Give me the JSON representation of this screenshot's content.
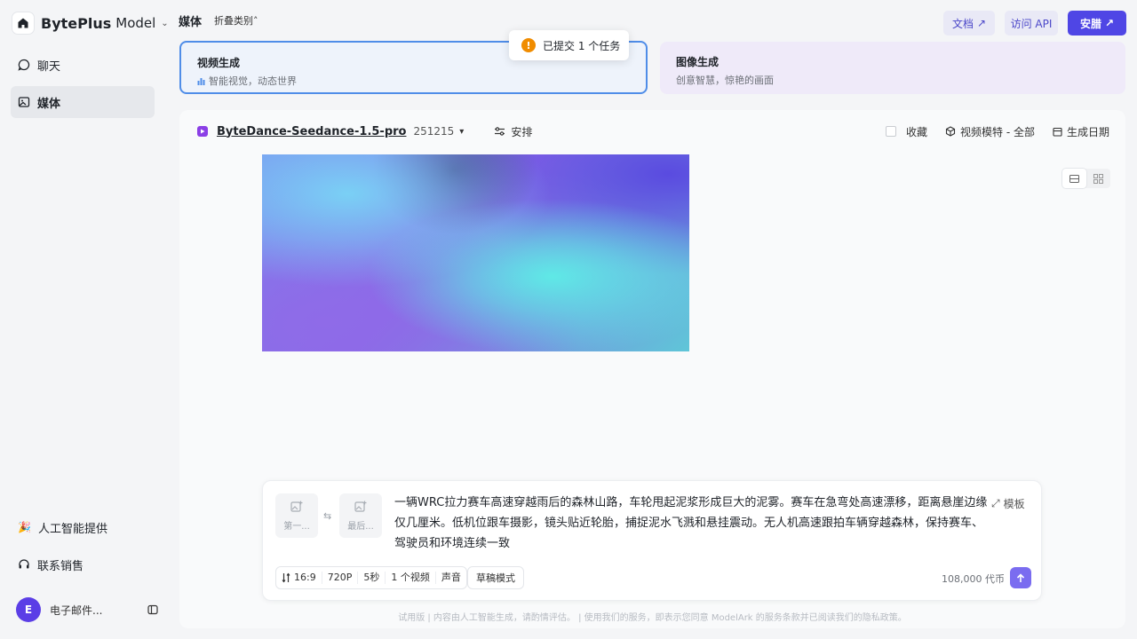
{
  "sidebar": {
    "brand": {
      "name": "BytePlus",
      "product": "Model"
    },
    "items": [
      {
        "label": "聊天",
        "icon": "chat-icon"
      },
      {
        "label": "媒体",
        "icon": "media-icon",
        "active": true
      }
    ],
    "bottom_items": [
      {
        "label": "人工智能提供",
        "icon": "party-icon"
      },
      {
        "label": "联系销售",
        "icon": "headset-icon"
      }
    ],
    "user": {
      "initial": "E",
      "name": "电子邮件..."
    }
  },
  "header": {
    "title": "媒体",
    "fold_label": "折叠类别",
    "docs_label": "文档",
    "api_label": "访问 API",
    "install_label": "安腊"
  },
  "categories": [
    {
      "title": "视频生成",
      "subtitle": "智能视觉，动态世界",
      "selected": true
    },
    {
      "title": "图像生成",
      "subtitle": "创意智慧，惊艳的画面",
      "selected": false
    }
  ],
  "toast": {
    "text": "已提交 1 个任务",
    "icon": "!"
  },
  "toolbar": {
    "model_name": "ByteDance-Seedance-1.5-pro",
    "model_version": "251215",
    "arrange_label": "安排",
    "favorites_label": "收藏",
    "filter_label": "视频模特 - 全部",
    "date_label": "生成日期"
  },
  "prompt": {
    "first_frame_label": "第一...",
    "last_frame_label": "最后...",
    "text": "一辆WRC拉力赛车高速穿越雨后的森林山路，车轮甩起泥浆形成巨大的泥雾。赛车在急弯处高速漂移，距离悬崖边缘仅几厘米。低机位跟车摄影，镜头贴近轮胎，捕捉泥水飞溅和悬挂震动。无人机高速跟拍车辆穿越森林，保持赛车、驾驶员和环境连续一致",
    "template_label": "模板",
    "options": {
      "ratio": "16:9",
      "resolution": "720P",
      "duration": "5秒",
      "count": "1 个视频",
      "audio": "声音"
    },
    "draft_label": "草稿模式",
    "credits": "108,000 代币"
  },
  "footer": "试用版 | 内容由人工智能生成，请酌情评估。 | 使用我们的服务，即表示您同意 ModelArk 的服务条款并已阅读我们的隐私政策。",
  "colors": {
    "accent": "#4f46e5",
    "selected_border": "#4f8de8",
    "toast_warning": "#f08c00",
    "avatar": "#5b3ee6"
  }
}
